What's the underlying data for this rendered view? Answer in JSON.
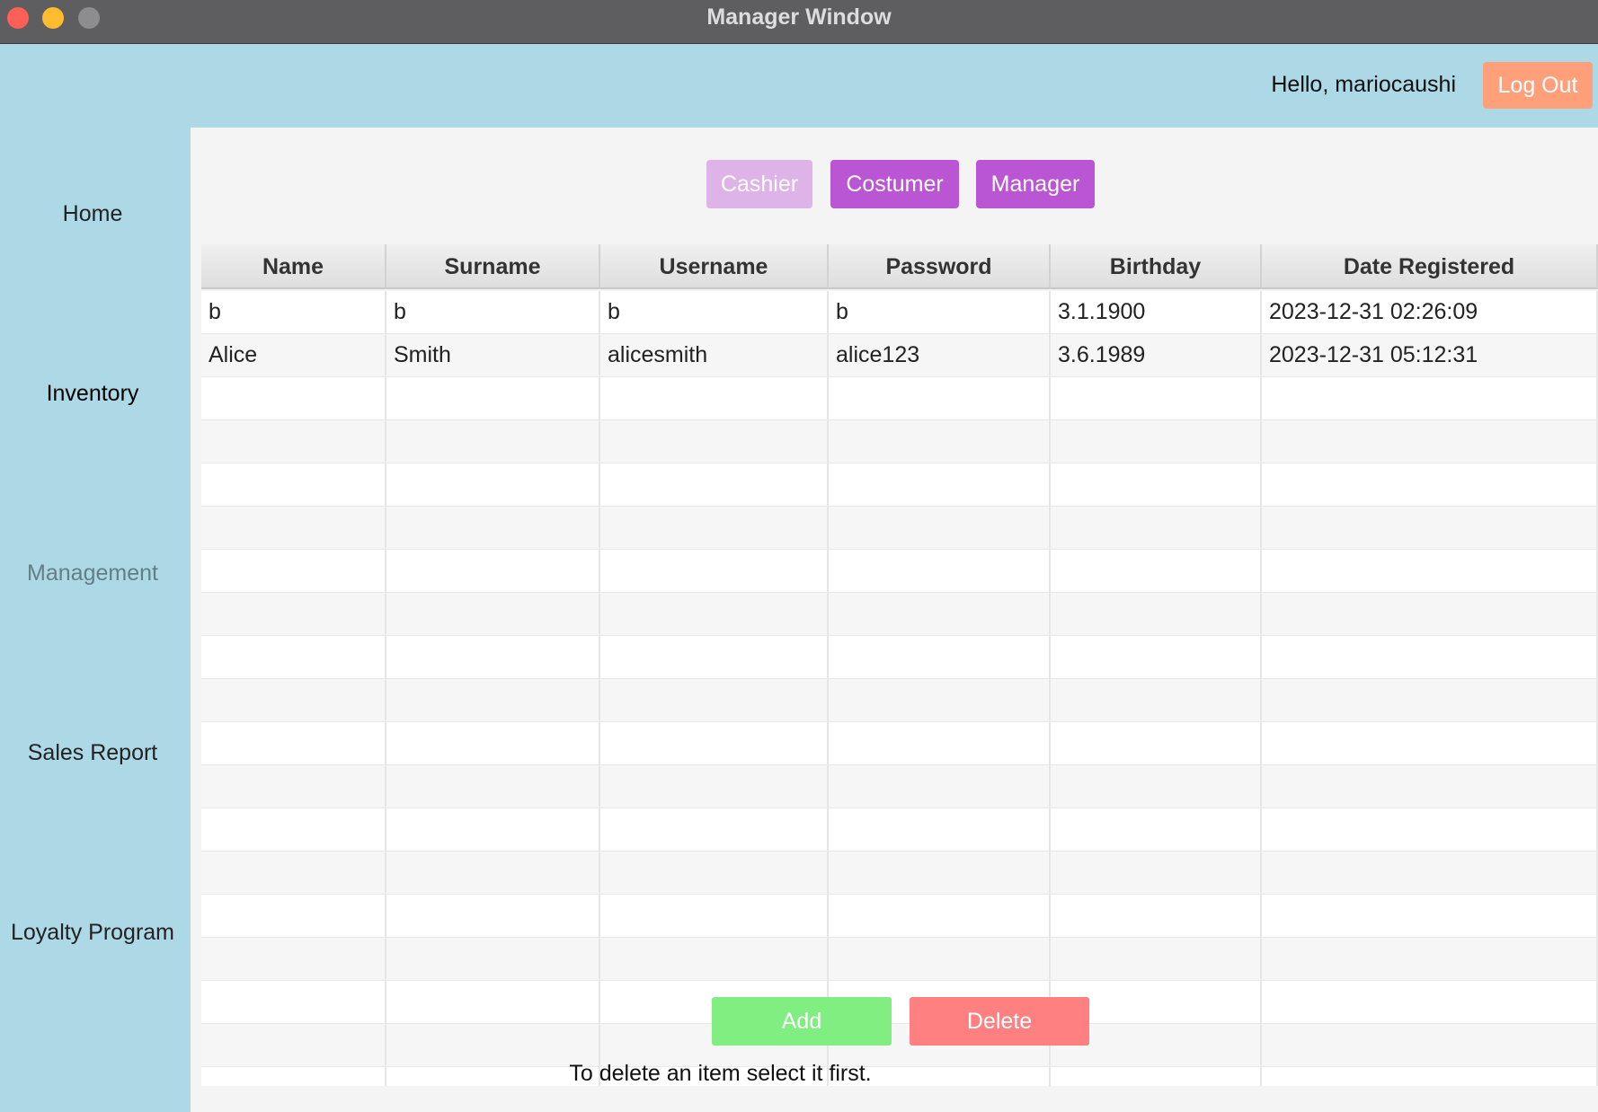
{
  "window": {
    "title": "Manager Window"
  },
  "header": {
    "greeting": "Hello, mariocaushi",
    "logout_label": "Log Out"
  },
  "sidebar": {
    "items": [
      {
        "label": "Home"
      },
      {
        "label": "Inventory"
      },
      {
        "label": "Management",
        "active": true
      },
      {
        "label": "Sales Report"
      },
      {
        "label": "Loyalty Program"
      }
    ]
  },
  "roles": {
    "cashier": "Cashier",
    "costumer": "Costumer",
    "manager": "Manager",
    "selected": "Cashier"
  },
  "table": {
    "columns": [
      "Name",
      "Surname",
      "Username",
      "Password",
      "Birthday",
      "Date Registered"
    ],
    "rows": [
      [
        "b",
        "b",
        "b",
        "b",
        "3.1.1900",
        "2023-12-31 02:26:09"
      ],
      [
        "Alice",
        "Smith",
        "alicesmith",
        "alice123",
        "3.6.1989",
        "2023-12-31 05:12:31"
      ]
    ]
  },
  "actions": {
    "add_label": "Add",
    "delete_label": "Delete",
    "hint": "To delete an item select it first."
  },
  "colors": {
    "background": "#ADD8E6",
    "role_button": "#BA55D3",
    "role_button_selected": "#DDB3E8",
    "add": "#80EE80",
    "delete": "#FF8080",
    "logout": "#FFA07A"
  }
}
